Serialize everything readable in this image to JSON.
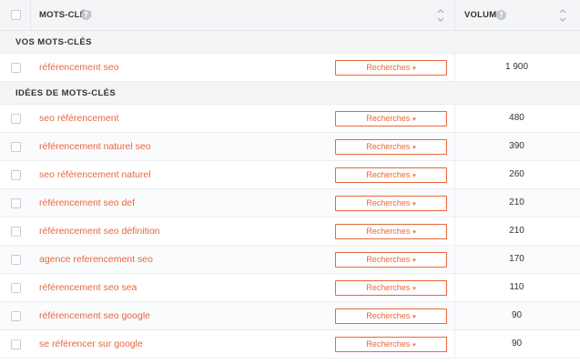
{
  "header": {
    "keywords_label": "MOTS-CLÉS",
    "volume_label": "VOLUME",
    "help_glyph": "?"
  },
  "sections": {
    "yours": "VOS MOTS-CLÉS",
    "ideas": "IDÉES DE MOTS-CLÉS"
  },
  "button_label": "Recherches",
  "button_chevron": "▾",
  "your_keywords": [
    {
      "keyword": "référencement seo",
      "volume": "1 900"
    }
  ],
  "keyword_ideas": [
    {
      "keyword": "seo référencement",
      "volume": "480"
    },
    {
      "keyword": "référencement naturel seo",
      "volume": "390"
    },
    {
      "keyword": "seo référencement naturel",
      "volume": "260"
    },
    {
      "keyword": "référencement seo def",
      "volume": "210"
    },
    {
      "keyword": "référencement seo définition",
      "volume": "210"
    },
    {
      "keyword": "agence referencement seo",
      "volume": "170"
    },
    {
      "keyword": "référencement seo sea",
      "volume": "110"
    },
    {
      "keyword": "référencement seo google",
      "volume": "90"
    },
    {
      "keyword": "se référencer sur google",
      "volume": "90"
    }
  ],
  "colors": {
    "accent": "#e8673d",
    "header_bg": "#f4f5f7",
    "border": "#e4e6ea"
  }
}
